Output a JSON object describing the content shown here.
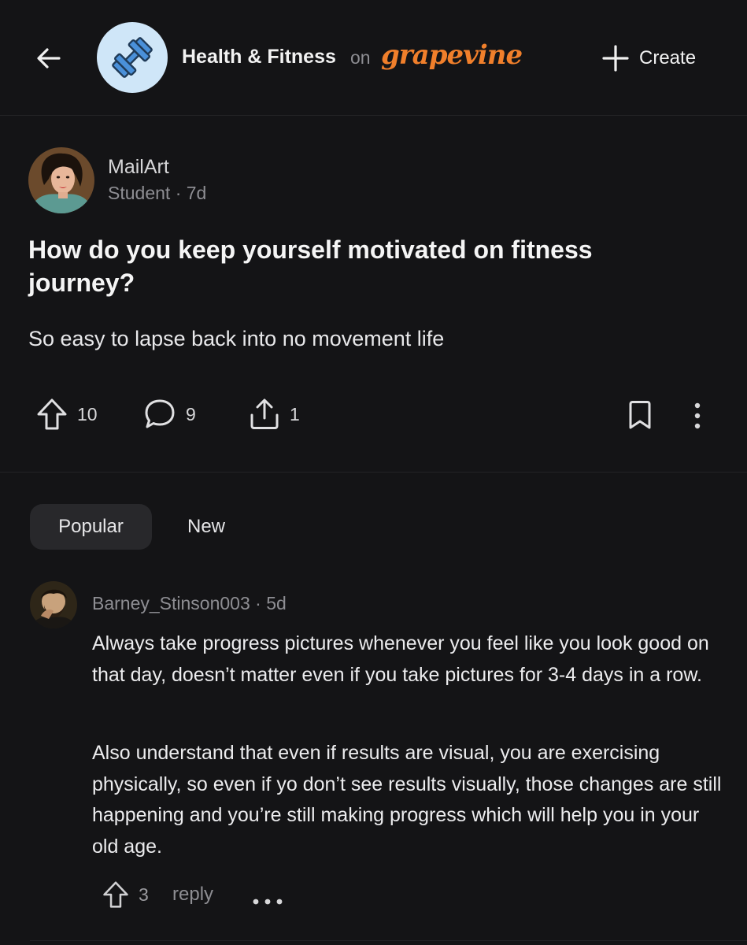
{
  "header": {
    "community_name": "Health & Fitness",
    "on_text": "on",
    "brand": "grapevine",
    "create_label": "Create"
  },
  "post": {
    "author": "MailArt",
    "role": "Student",
    "time": "7d",
    "title": "How do you keep yourself motivated on fitness journey?",
    "body": "So easy to lapse back into no movement life",
    "upvotes": "10",
    "comments": "9",
    "shares": "1"
  },
  "sort_tabs": {
    "popular": "Popular",
    "new": "New"
  },
  "comment": {
    "author": "Barney_Stinson003",
    "time": "5d",
    "paragraph1": "Always take progress pictures whenever you feel like you look good on that day, doesn’t matter even if you take pictures for 3-4 days in a row.",
    "paragraph2": "Also understand that even if results are visual, you are exercising physically, so even if yo don’t see results visually, those changes are still happening and you’re still making progress which will help you in your old age.",
    "upvotes": "3",
    "reply_label": "reply"
  },
  "colors": {
    "background": "#141416",
    "brand": "#f07f2b",
    "community_avatar_bg": "#cfe6f8",
    "muted_text": "#8e8e93"
  },
  "icons": [
    "arrow-left-icon",
    "dumbbell-icon",
    "plus-icon",
    "upvote-arrow-icon",
    "comment-bubble-icon",
    "share-icon",
    "bookmark-icon",
    "more-vertical-icon",
    "more-horizontal-icon"
  ]
}
